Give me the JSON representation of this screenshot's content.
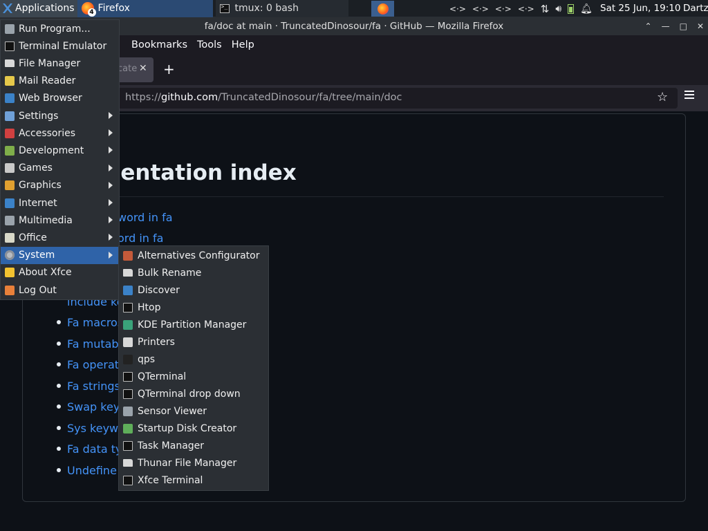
{
  "panel": {
    "applications_label": "Applications",
    "tasks": [
      {
        "label": "Firefox",
        "badge": "4"
      },
      {
        "label": "tmux: 0 bash"
      }
    ],
    "clock": "Sat 25 Jun, 19:10",
    "user": "Dartz"
  },
  "window": {
    "title": "fa/doc at main · TruncatedDinosour/fa · GitHub — Mozilla Firefox",
    "menus": [
      "Bookmarks",
      "Tools",
      "Help"
    ],
    "tab_partial_title": "cate",
    "url_scheme": "https://",
    "url_host": "github.com",
    "url_path": "/TruncatedDinosour/fa/tree/main/doc"
  },
  "page": {
    "heading": "umentation index",
    "links": [
      "word in fa",
      "ord in fa",
      "include ke",
      "Fa macros",
      "Fa mutabil",
      "Fa operato",
      "Fa strings",
      "Swap keyw",
      "Sys keywo",
      "Fa data typ",
      "Undefine k"
    ]
  },
  "app_menu": {
    "items": [
      {
        "label": "Run Program...",
        "icon": "run-icon",
        "color": "#9aa3ab"
      },
      {
        "label": "Terminal Emulator",
        "icon": "terminal-icon",
        "color": "#111111"
      },
      {
        "label": "File Manager",
        "icon": "folder-icon",
        "color": "#d8d8d8"
      },
      {
        "label": "Mail Reader",
        "icon": "mail-icon",
        "color": "#e5c84a"
      },
      {
        "label": "Web Browser",
        "icon": "globe-icon",
        "color": "#3b82c8"
      },
      {
        "label": "Settings",
        "icon": "settings-icon",
        "color": "#6fa0d8",
        "submenu": true
      },
      {
        "label": "Accessories",
        "icon": "accessories-icon",
        "color": "#d04040",
        "submenu": true
      },
      {
        "label": "Development",
        "icon": "development-icon",
        "color": "#7fae4a",
        "submenu": true
      },
      {
        "label": "Games",
        "icon": "games-icon",
        "color": "#c9c9c9",
        "submenu": true
      },
      {
        "label": "Graphics",
        "icon": "graphics-icon",
        "color": "#e0a030",
        "submenu": true
      },
      {
        "label": "Internet",
        "icon": "internet-icon",
        "color": "#3b82c8",
        "submenu": true
      },
      {
        "label": "Multimedia",
        "icon": "multimedia-icon",
        "color": "#9aa3ab",
        "submenu": true
      },
      {
        "label": "Office",
        "icon": "office-icon",
        "color": "#d8d8c8",
        "submenu": true
      },
      {
        "label": "System",
        "icon": "system-gear-icon",
        "color": "#b7bcc2",
        "submenu": true,
        "selected": true
      },
      {
        "label": "About Xfce",
        "icon": "star-icon",
        "color": "#f2c230"
      },
      {
        "label": "Log Out",
        "icon": "logout-icon",
        "color": "#e8803a"
      }
    ]
  },
  "system_submenu": {
    "items": [
      {
        "label": "Alternatives Configurator",
        "icon": "debian-icon",
        "color": "#c45a3a"
      },
      {
        "label": "Bulk Rename",
        "icon": "folder-icon",
        "color": "#d8d8d8"
      },
      {
        "label": "Discover",
        "icon": "discover-icon",
        "color": "#3b82c8"
      },
      {
        "label": "Htop",
        "icon": "htop-icon",
        "color": "#111111"
      },
      {
        "label": "KDE Partition Manager",
        "icon": "partition-icon",
        "color": "#3aa37a"
      },
      {
        "label": "Printers",
        "icon": "printer-icon",
        "color": "#d8d8d8"
      },
      {
        "label": "qps",
        "icon": "qps-icon",
        "color": "#222222"
      },
      {
        "label": "QTerminal",
        "icon": "terminal-icon",
        "color": "#111111"
      },
      {
        "label": "QTerminal drop down",
        "icon": "terminal-icon",
        "color": "#111111"
      },
      {
        "label": "Sensor Viewer",
        "icon": "sensor-icon",
        "color": "#9aa3ab"
      },
      {
        "label": "Startup Disk Creator",
        "icon": "usb-icon",
        "color": "#5fae5a"
      },
      {
        "label": "Task Manager",
        "icon": "task-manager-icon",
        "color": "#111111"
      },
      {
        "label": "Thunar File Manager",
        "icon": "folder-icon",
        "color": "#d8d8d8"
      },
      {
        "label": "Xfce Terminal",
        "icon": "terminal-icon",
        "color": "#111111"
      }
    ]
  }
}
